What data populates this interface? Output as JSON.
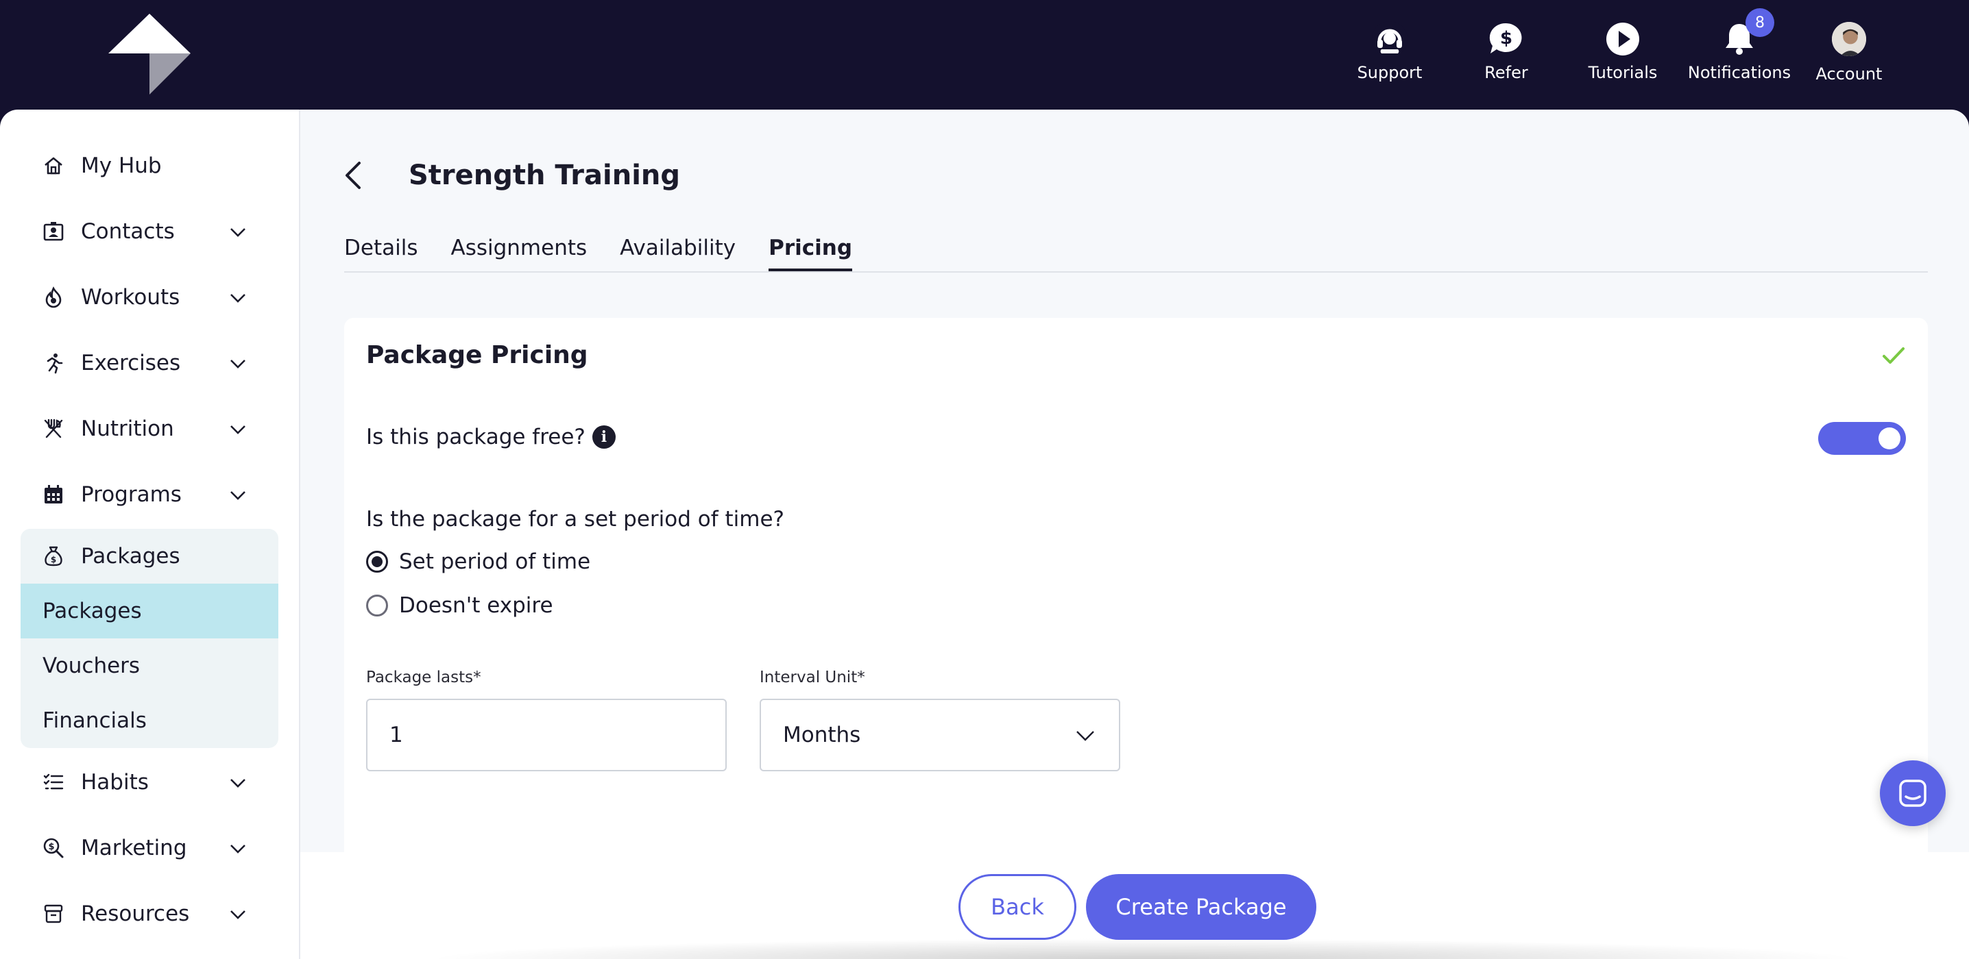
{
  "topnav": {
    "support": "Support",
    "refer": "Refer",
    "tutorials": "Tutorials",
    "notifications": "Notifications",
    "notifications_count": "8",
    "account": "Account"
  },
  "sidebar": {
    "items": [
      {
        "label": "My Hub",
        "icon": "home-icon"
      },
      {
        "label": "Contacts",
        "icon": "contacts-icon"
      },
      {
        "label": "Workouts",
        "icon": "flame-icon"
      },
      {
        "label": "Exercises",
        "icon": "running-icon"
      },
      {
        "label": "Nutrition",
        "icon": "utensils-icon"
      },
      {
        "label": "Programs",
        "icon": "calendar-icon"
      },
      {
        "label": "Packages",
        "icon": "money-bag-icon"
      },
      {
        "label": "Habits",
        "icon": "checklist-icon"
      },
      {
        "label": "Marketing",
        "icon": "search-dollar-icon"
      },
      {
        "label": "Resources",
        "icon": "archive-icon"
      }
    ],
    "packages_sub": [
      "Packages",
      "Vouchers",
      "Financials"
    ]
  },
  "page": {
    "title": "Strength Training",
    "tabs": [
      "Details",
      "Assignments",
      "Availability",
      "Pricing"
    ],
    "active_tab": "Pricing"
  },
  "pricing": {
    "heading": "Package Pricing",
    "free_question": "Is this package free?",
    "free_enabled": true,
    "period_question": "Is the package for a set period of time?",
    "options": [
      "Set period of time",
      "Doesn't expire"
    ],
    "selected_option": "Set period of time",
    "lasts_label": "Package lasts*",
    "lasts_value": "1",
    "unit_label": "Interval Unit*",
    "unit_value": "Months"
  },
  "footer": {
    "back_label": "Back",
    "create_label": "Create Package"
  },
  "colors": {
    "accent": "#5b63e6",
    "topbar": "#14112e",
    "active_sub": "#bde7ef",
    "check": "#7ac943"
  }
}
